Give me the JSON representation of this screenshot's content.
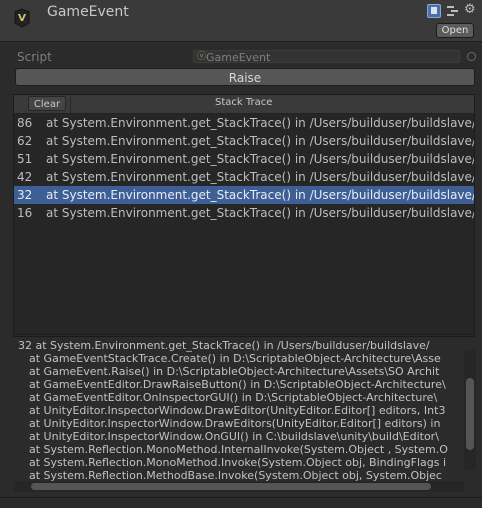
{
  "header": {
    "title": "GameEvent",
    "open_label": "Open",
    "icons": [
      "scriptable-object-icon",
      "help-icon",
      "preset-icon",
      "gear-icon"
    ]
  },
  "script_field": {
    "label": "Script",
    "value": "GameEvent"
  },
  "raise_label": "Raise",
  "list": {
    "clear_label": "Clear",
    "header": "Stack Trace",
    "rows": [
      {
        "id": "86",
        "text": "at System.Environment.get_StackTrace() in /Users/builduser/buildslave/mo"
      },
      {
        "id": "62",
        "text": "at System.Environment.get_StackTrace() in /Users/builduser/buildslave/mo"
      },
      {
        "id": "51",
        "text": "at System.Environment.get_StackTrace() in /Users/builduser/buildslave/mo"
      },
      {
        "id": "42",
        "text": "at System.Environment.get_StackTrace() in /Users/builduser/buildslave/mo"
      },
      {
        "id": "32",
        "text": "at System.Environment.get_StackTrace() in /Users/builduser/buildslave/mo",
        "selected": true
      },
      {
        "id": "16",
        "text": "at System.Environment.get_StackTrace() in /Users/builduser/buildslave/mo"
      }
    ]
  },
  "detail": {
    "lines": [
      "32    at System.Environment.get_StackTrace() in /Users/builduser/buildslave/",
      "at GameEventStackTrace.Create() in D:\\ScriptableObject-Architecture\\Asse",
      "at GameEvent.Raise() in D:\\ScriptableObject-Architecture\\Assets\\SO Archit",
      "at GameEventEditor.DrawRaiseButton() in D:\\ScriptableObject-Architecture\\",
      "at GameEventEditor.OnInspectorGUI() in D:\\ScriptableObject-Architecture\\",
      "at UnityEditor.InspectorWindow.DrawEditor(UnityEditor.Editor[] editors, Int3",
      "at UnityEditor.InspectorWindow.DrawEditors(UnityEditor.Editor[] editors) in",
      "at UnityEditor.InspectorWindow.OnGUI() in C:\\buildslave\\unity\\build\\Editor\\",
      "at System.Reflection.MonoMethod.InternalInvoke(System.Object , System.O",
      "at System.Reflection.MonoMethod.Invoke(System.Object obj, BindingFlags i",
      "at System.Reflection.MethodBase.Invoke(System.Object obj, System.Objec"
    ]
  },
  "colors": {
    "selection": "#3e5f96",
    "background": "#2b2b2b"
  }
}
